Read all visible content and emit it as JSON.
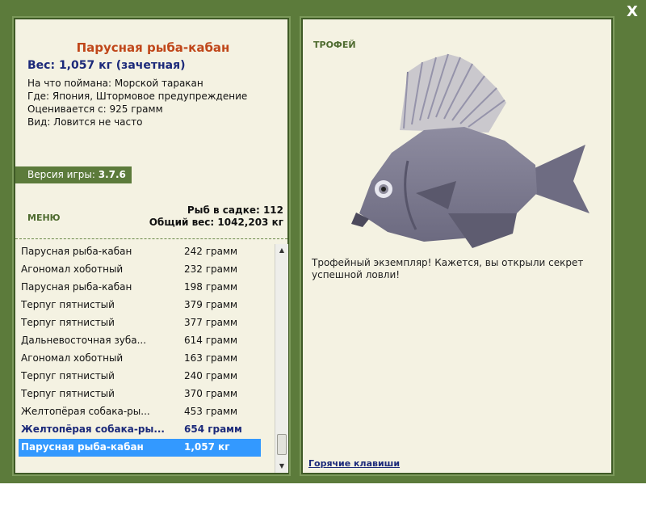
{
  "close": {
    "label": "X"
  },
  "left": {
    "title": "Парусная рыба-кабан",
    "weight": "Вес: 1,057 кг (зачетная)",
    "info": [
      "На что поймана: Морской таракан",
      "Где: Япония, Штормовое предупреждение",
      "Оценивается с: 925 грамм",
      "Вид: Ловится не часто"
    ],
    "version_label": "Версия игры:",
    "version_value": "3.7.6",
    "menu": "МЕНЮ",
    "fish_count": "Рыб в садке: 112",
    "total_weight": "Общий вес: 1042,203 кг"
  },
  "catch_list": [
    {
      "name": "Парусная рыба-кабан",
      "weight": "242 грамм"
    },
    {
      "name": "Агономал хоботный",
      "weight": "232 грамм"
    },
    {
      "name": "Парусная рыба-кабан",
      "weight": "198 грамм"
    },
    {
      "name": "Терпуг пятнистый",
      "weight": "379 грамм"
    },
    {
      "name": "Терпуг пятнистый",
      "weight": "377 грамм"
    },
    {
      "name": "Дальневосточная зуба...",
      "weight": "614 грамм"
    },
    {
      "name": "Агономал хоботный",
      "weight": "163 грамм"
    },
    {
      "name": "Терпуг пятнистый",
      "weight": "240 грамм"
    },
    {
      "name": "Терпуг пятнистый",
      "weight": "370 грамм"
    },
    {
      "name": "Желтопёрая собака-ры...",
      "weight": "453 грамм"
    },
    {
      "name": "Желтопёрая собака-ры...",
      "weight": "654 грамм"
    },
    {
      "name": "Парусная рыба-кабан",
      "weight": "1,057 кг"
    }
  ],
  "right": {
    "badge": "ТРОФЕЙ",
    "description": "Трофейный экземпляр! Кажется, вы открыли секрет успешной ловли!",
    "hotkeys": "Горячие клавиши"
  },
  "colors": {
    "frame": "#5c7b3b",
    "panel": "#f4f2e2",
    "title": "#c0471a",
    "accent_blue": "#1c2a7a",
    "selection": "#3399ff"
  },
  "icons": {
    "close": "close-icon",
    "scroll_up": "arrow-up-icon",
    "scroll_down": "arrow-down-icon",
    "fish": "fish-picture"
  }
}
